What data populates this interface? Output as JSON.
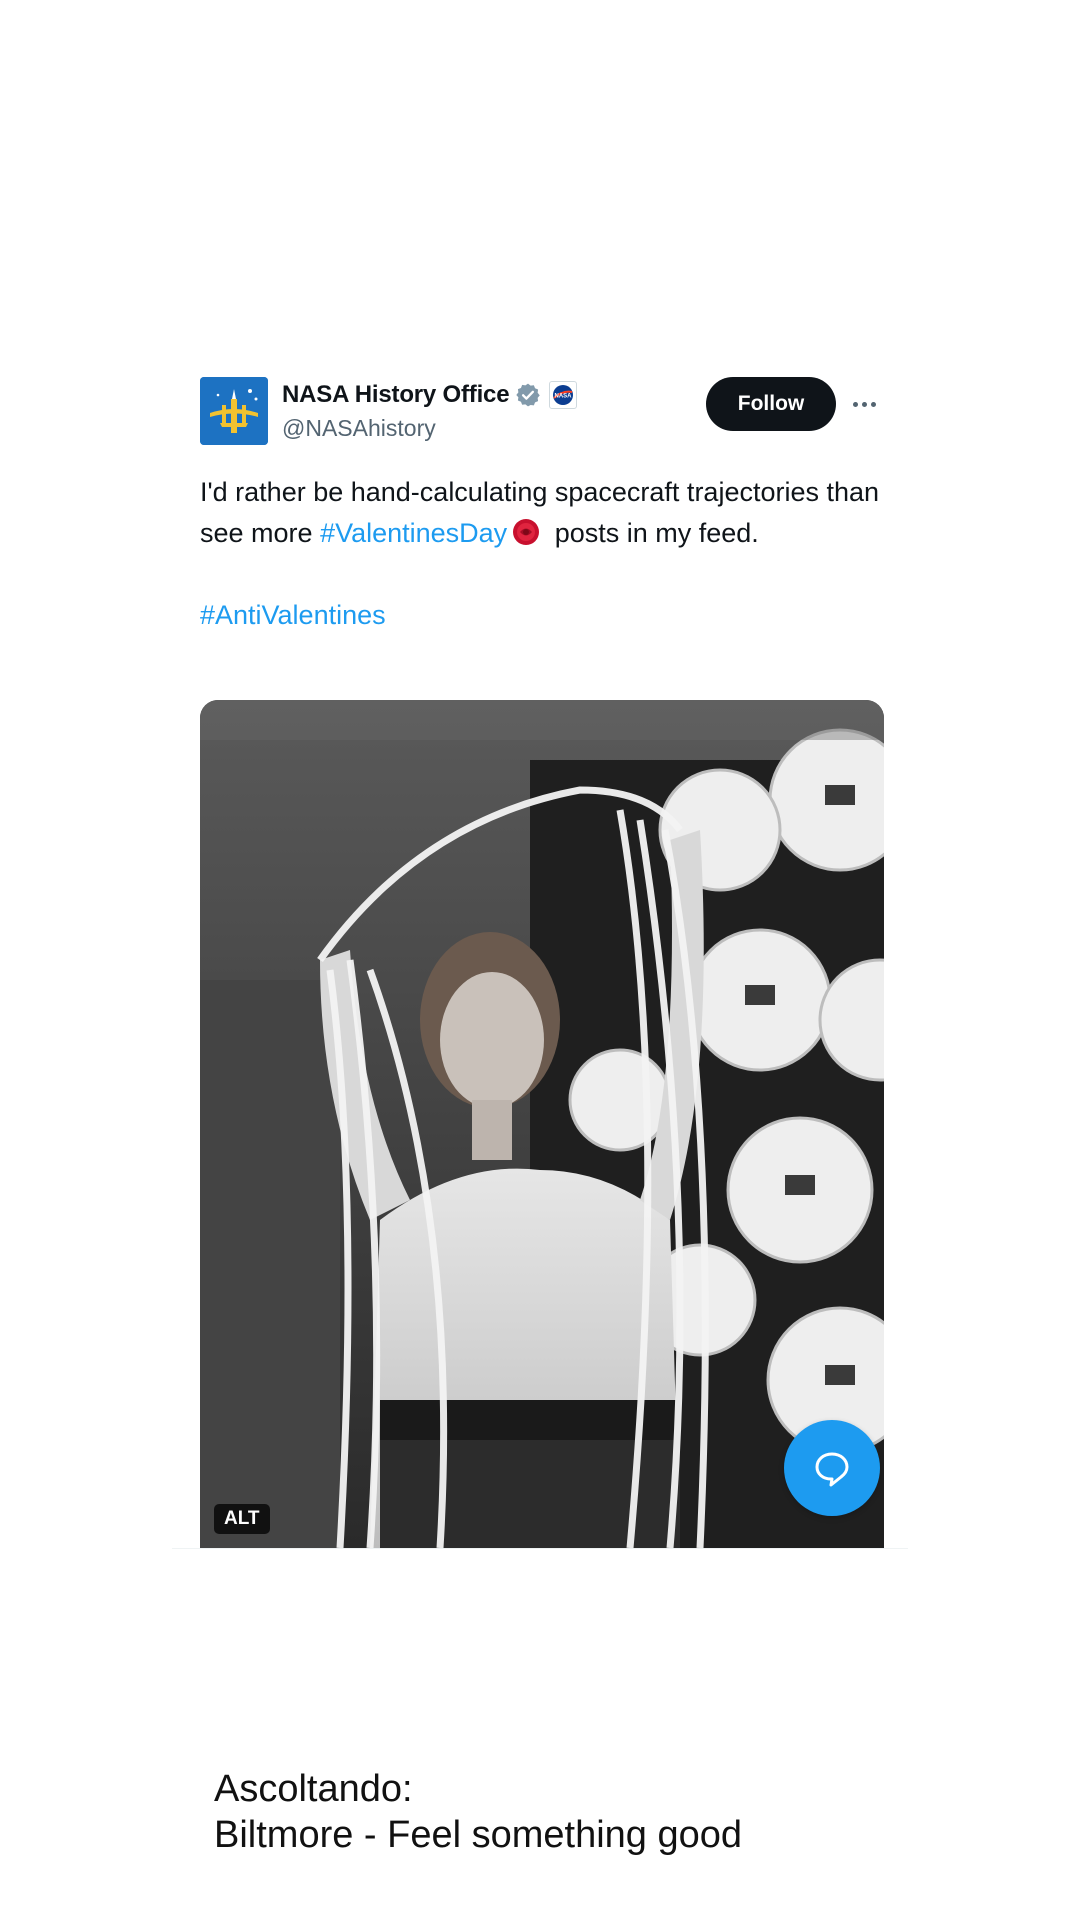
{
  "tweet": {
    "author": {
      "display_name": "NASA History Office",
      "handle": "@NASAhistory",
      "verified": true,
      "avatar_icon": "nasa-history-logo",
      "affiliation_icon": "nasa-meatball-logo"
    },
    "follow_label": "Follow",
    "more_icon": "more-dots-icon",
    "text": {
      "part1": "I'd rather be hand-calculating spacecraft trajectories than see more ",
      "hashtag1": "#ValentinesDay",
      "emoji": "rose-icon",
      "part2": " posts in my feed.",
      "hashtag2": "#AntiValentines"
    },
    "media": {
      "description_icon": "photo",
      "alt_label": "ALT"
    },
    "reply_icon": "reply-bubble-icon"
  },
  "colors": {
    "accent": "#1d9bf0",
    "text": "#0f1419",
    "muted": "#536471",
    "follow_bg": "#0f1419"
  },
  "caption": {
    "line1": "Ascoltando:",
    "line2": "Biltmore - Feel something good"
  }
}
